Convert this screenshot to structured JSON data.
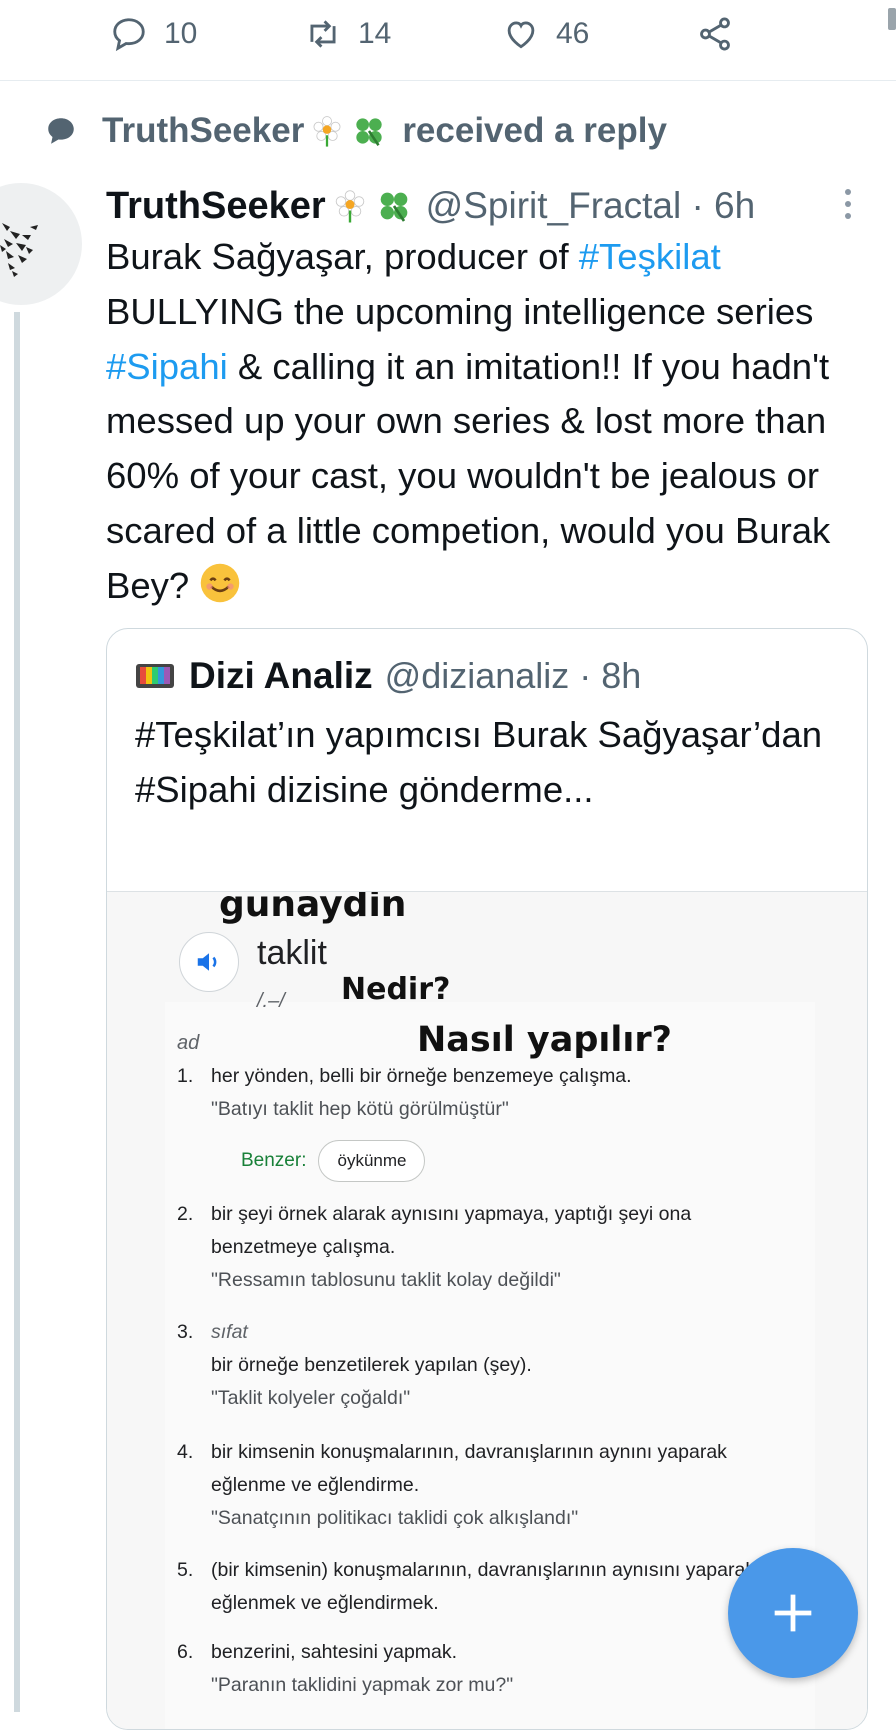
{
  "action_bar": {
    "reply_count": "10",
    "retweet_count": "14",
    "like_count": "46"
  },
  "context": {
    "user": "TruthSeeker",
    "text": "received a reply"
  },
  "tweet": {
    "display_name": "TruthSeeker",
    "handle_time": "@Spirit_Fractal · 6h",
    "body": {
      "p1": "Burak Sağyaşar, producer of ",
      "h1": "#Teşkilat",
      "p2": " BULLYING the upcoming intelligence series ",
      "h2": "#Sipahi",
      "p3": " & calling it an imitation!! If you hadn't messed up your own series & lost more than 60% of your cast, you wouldn't be jealous or scared of a little competion, would you Burak Bey? "
    }
  },
  "quote": {
    "name": "Dizi Analiz",
    "handle_time": "@dizianaliz · 8h",
    "text": "#Teşkilat’ın yapımcısı Burak Sağyaşar’dan #Sipahi dizisine gönderme...",
    "image": {
      "meme_top": "gunaydin",
      "meme_mid": "Nedir?",
      "meme_bottom": "Nasıl yapılır?",
      "word": "taklit",
      "phonetic": "/.–/",
      "part_of_speech": "ad",
      "definitions": [
        {
          "num": "1.",
          "text": "her yönden, belli bir örneğe benzemeye çalışma.",
          "example": "\"Batıyı taklit hep kötü görülmüştür\""
        },
        {
          "num": "2.",
          "text": "bir şeyi örnek alarak aynısını yapmaya, yaptığı şeyi ona benzetmeye çalışma.",
          "example": "\"Ressamın tablosunu taklit kolay değildi\""
        },
        {
          "num": "3.",
          "word_form": "sıfat",
          "text": "bir örneğe benzetilerek yapılan (şey).",
          "example": "\"Taklit kolyeler çoğaldı\""
        },
        {
          "num": "4.",
          "text": "bir kimsenin konuşmalarının, davranışlarının aynını yaparak eğlenme ve eğlendirme.",
          "example": "\"Sanatçının politikacı taklidi çok alkışlandı\""
        },
        {
          "num": "5.",
          "text": "(bir kimsenin) konuşmalarının, davranışlarının aynısını yaparak eğlenmek ve eğlendirmek."
        },
        {
          "num": "6.",
          "text": "benzerini, sahtesini yapmak.",
          "example": "\"Paranın taklidini yapmak zor mu?\""
        }
      ],
      "similar_label": "Benzer:",
      "similar_chip": "öykünme"
    }
  },
  "colors": {
    "accent": "#1d9bf0",
    "secondary_text": "#536471",
    "fab": "#4a98e9"
  },
  "icons": [
    "reply-icon",
    "retweet-icon",
    "heart-icon",
    "share-icon",
    "speech-bubble-icon",
    "flower-emoji-icon",
    "clover-emoji-icon",
    "more-icon",
    "smile-emoji-icon",
    "tv-emoji-icon",
    "speaker-icon",
    "plus-icon"
  ]
}
